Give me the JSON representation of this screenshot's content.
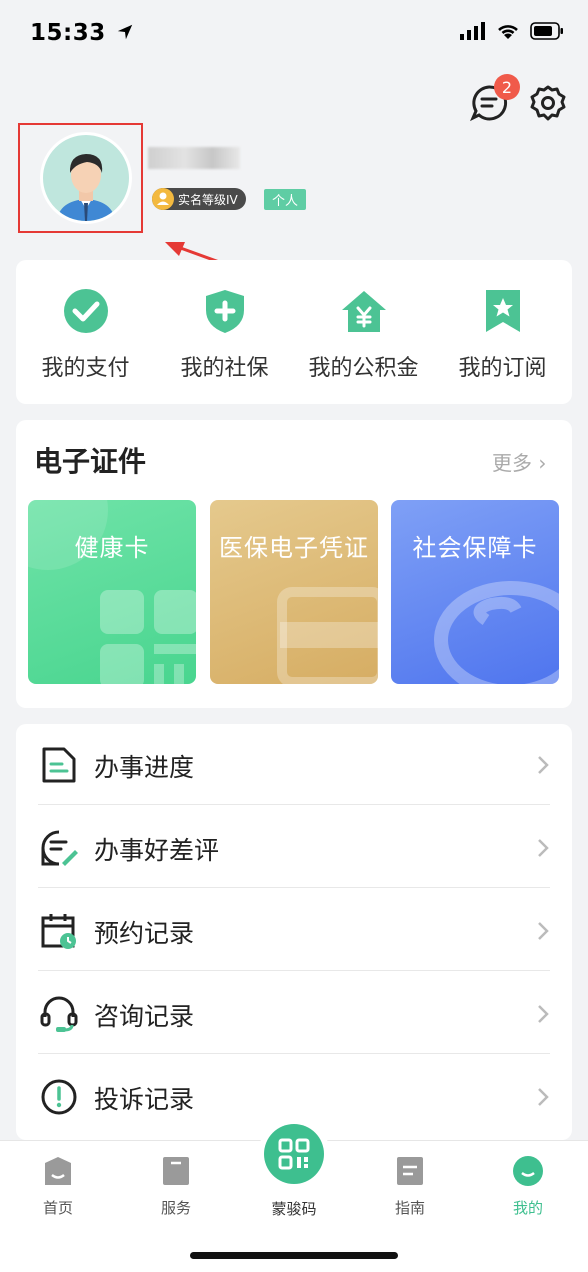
{
  "status_bar": {
    "time": "15:33"
  },
  "header": {
    "message_badge": "2"
  },
  "profile": {
    "realname_level": "实名等级IV",
    "account_type": "个人"
  },
  "quick_actions": [
    {
      "label": "我的支付",
      "icon": "check-circle-icon"
    },
    {
      "label": "我的社保",
      "icon": "shield-plus-icon"
    },
    {
      "label": "我的公积金",
      "icon": "house-yen-icon"
    },
    {
      "label": "我的订阅",
      "icon": "bookmark-star-icon"
    }
  ],
  "certificates": {
    "title": "电子证件",
    "more": "更多 ›",
    "items": [
      {
        "label": "健康卡"
      },
      {
        "label": "医保电子凭证"
      },
      {
        "label": "社会保障卡"
      }
    ]
  },
  "records": [
    {
      "label": "办事进度",
      "icon": "document-icon"
    },
    {
      "label": "办事好差评",
      "icon": "review-edit-icon"
    },
    {
      "label": "预约记录",
      "icon": "calendar-clock-icon"
    },
    {
      "label": "咨询记录",
      "icon": "headset-icon"
    },
    {
      "label": "投诉记录",
      "icon": "exclamation-circle-icon"
    }
  ],
  "tabbar": {
    "home": "首页",
    "service": "服务",
    "code": "蒙骏码",
    "guide": "指南",
    "mine": "我的"
  },
  "colors": {
    "accent": "#3ebf8f",
    "badge": "#f05a4a",
    "highlight_frame": "#e53935"
  }
}
